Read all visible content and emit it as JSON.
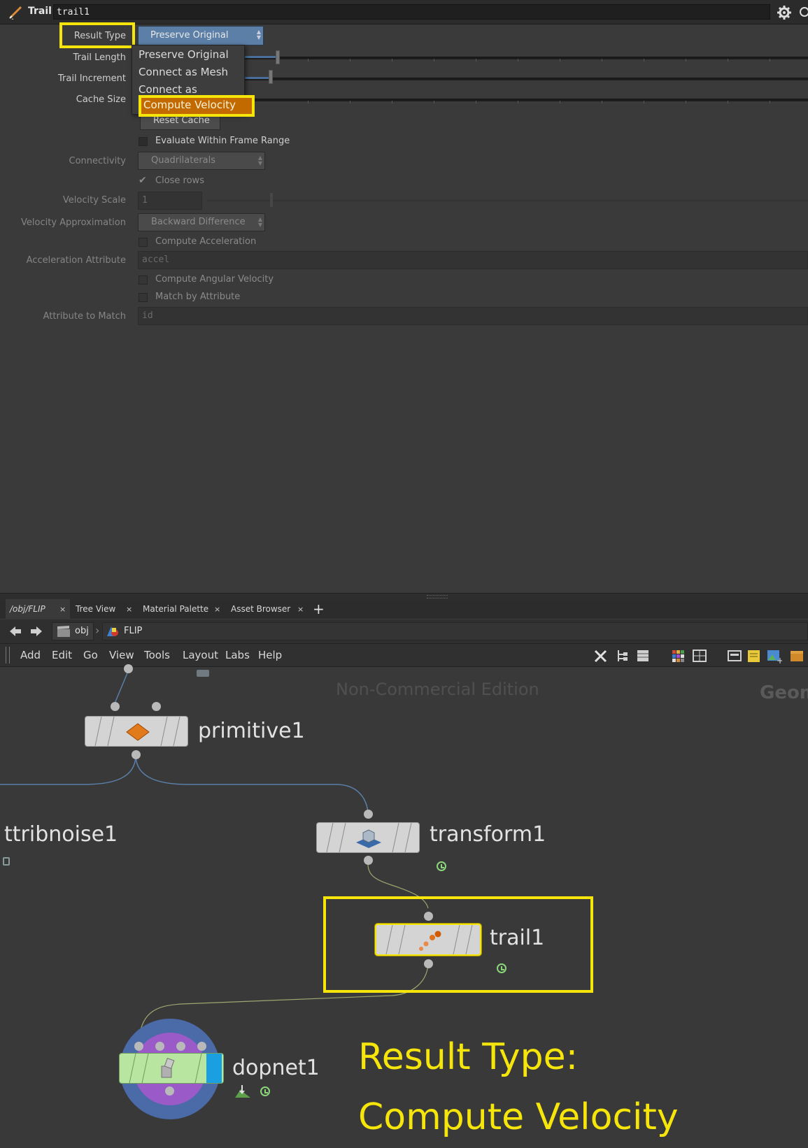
{
  "params": {
    "node_type": "Trail",
    "node_name": "trail1",
    "result_type_label": "Result Type",
    "result_type_value": "Preserve Original",
    "trail_length_label": "Trail Length",
    "trail_increment_label": "Trail Increment",
    "cache_size_label": "Cache Size",
    "reset_cache_label": "Reset Cache",
    "evaluate_range_label": "Evaluate Within Frame Range",
    "connectivity_label": "Connectivity",
    "connectivity_value": "Quadrilaterals",
    "close_rows_label": "Close rows",
    "velocity_scale_label": "Velocity Scale",
    "velocity_scale_value": "1",
    "velocity_approx_label": "Velocity Approximation",
    "velocity_approx_value": "Backward Difference",
    "compute_accel_label": "Compute Acceleration",
    "accel_attr_label": "Acceleration Attribute",
    "accel_attr_value": "accel",
    "compute_angular_label": "Compute Angular Velocity",
    "match_attr_label": "Match by Attribute",
    "attr_to_match_label": "Attribute to Match",
    "attr_to_match_value": "id"
  },
  "dropdown": {
    "options": [
      "Preserve Original",
      "Connect as Mesh",
      "Connect as Polygons",
      "Compute Velocity"
    ],
    "highlighted": "Compute Velocity"
  },
  "tabs": [
    {
      "label": "/obj/FLIP"
    },
    {
      "label": "Tree View"
    },
    {
      "label": "Material Palette"
    },
    {
      "label": "Asset Browser"
    }
  ],
  "path": {
    "level1": "obj",
    "level2": "FLIP"
  },
  "menu": [
    "Add",
    "Edit",
    "Go",
    "View",
    "Tools",
    "Layout",
    "Labs",
    "Help"
  ],
  "network": {
    "watermark": "Non-Commercial Edition",
    "context_label": "Geom",
    "nodes": {
      "primitive1": "primitive1",
      "transform1": "transform1",
      "attribnoise1": "ttribnoise1",
      "trail1": "trail1",
      "dopnet1": "dopnet1"
    }
  },
  "annotation": {
    "line1": "Result Type:",
    "line2": "Compute Velocity"
  },
  "colors": {
    "highlight": "#f5e50a",
    "menu_selected": "#c26a00",
    "dropdown_active": "#5b7fa6"
  }
}
